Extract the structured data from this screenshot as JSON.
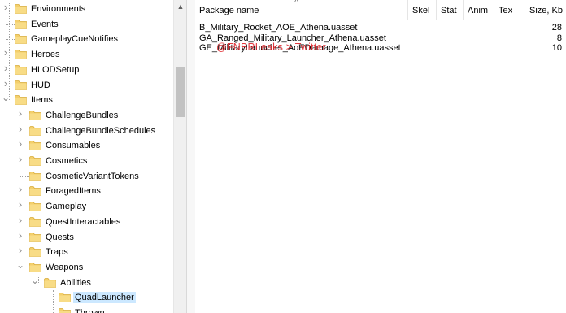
{
  "tree": {
    "items": [
      {
        "label": "Environments",
        "level": 0,
        "expander": "collapsed"
      },
      {
        "label": "Events",
        "level": 0,
        "expander": "none"
      },
      {
        "label": "GameplayCueNotifies",
        "level": 0,
        "expander": "none"
      },
      {
        "label": "Heroes",
        "level": 0,
        "expander": "collapsed"
      },
      {
        "label": "HLODSetup",
        "level": 0,
        "expander": "collapsed"
      },
      {
        "label": "HUD",
        "level": 0,
        "expander": "collapsed"
      },
      {
        "label": "Items",
        "level": 0,
        "expander": "expanded"
      },
      {
        "label": "ChallengeBundles",
        "level": 1,
        "expander": "collapsed"
      },
      {
        "label": "ChallengeBundleSchedules",
        "level": 1,
        "expander": "collapsed"
      },
      {
        "label": "Consumables",
        "level": 1,
        "expander": "collapsed"
      },
      {
        "label": "Cosmetics",
        "level": 1,
        "expander": "collapsed"
      },
      {
        "label": "CosmeticVariantTokens",
        "level": 1,
        "expander": "none"
      },
      {
        "label": "ForagedItems",
        "level": 1,
        "expander": "collapsed"
      },
      {
        "label": "Gameplay",
        "level": 1,
        "expander": "collapsed"
      },
      {
        "label": "QuestInteractables",
        "level": 1,
        "expander": "collapsed"
      },
      {
        "label": "Quests",
        "level": 1,
        "expander": "collapsed"
      },
      {
        "label": "Traps",
        "level": 1,
        "expander": "collapsed"
      },
      {
        "label": "Weapons",
        "level": 1,
        "expander": "expanded"
      },
      {
        "label": "Abilities",
        "level": 2,
        "expander": "expanded"
      },
      {
        "label": "QuadLauncher",
        "level": 3,
        "expander": "none",
        "selected": true
      },
      {
        "label": "Thrown",
        "level": 3,
        "expander": "none"
      }
    ]
  },
  "list": {
    "columns": [
      {
        "key": "name",
        "label": "Package name"
      },
      {
        "key": "skel",
        "label": "Skel"
      },
      {
        "key": "stat",
        "label": "Stat"
      },
      {
        "key": "anim",
        "label": "Anim"
      },
      {
        "key": "tex",
        "label": "Tex"
      },
      {
        "key": "size",
        "label": "Size, Kb"
      }
    ],
    "rows": [
      {
        "name": "B_Military_Rocket_AOE_Athena.uasset",
        "skel": "",
        "stat": "",
        "anim": "",
        "tex": "",
        "size": "28"
      },
      {
        "name": "GA_Ranged_Military_Launcher_Athena.uasset",
        "skel": "",
        "stat": "",
        "anim": "",
        "tex": "",
        "size": "8"
      },
      {
        "name": "GE_MilitaryLauncher_AoEDamage_Athena.uasset",
        "skel": "",
        "stat": "",
        "anim": "",
        "tex": "",
        "size": "10"
      }
    ]
  },
  "watermark": "@FNBRLeaks > Twitter",
  "colors": {
    "folder": "#f3cf6c",
    "folder_edge": "#d9ad3b",
    "selection": "#cce8ff",
    "watermark": "#e0242a"
  },
  "icons": {
    "collapsed": "chevron-right-icon",
    "expanded": "chevron-down-icon",
    "folder": "folder-icon",
    "scroll_up": "scroll-up-arrow-icon",
    "sort": "sort-ascending-icon"
  }
}
